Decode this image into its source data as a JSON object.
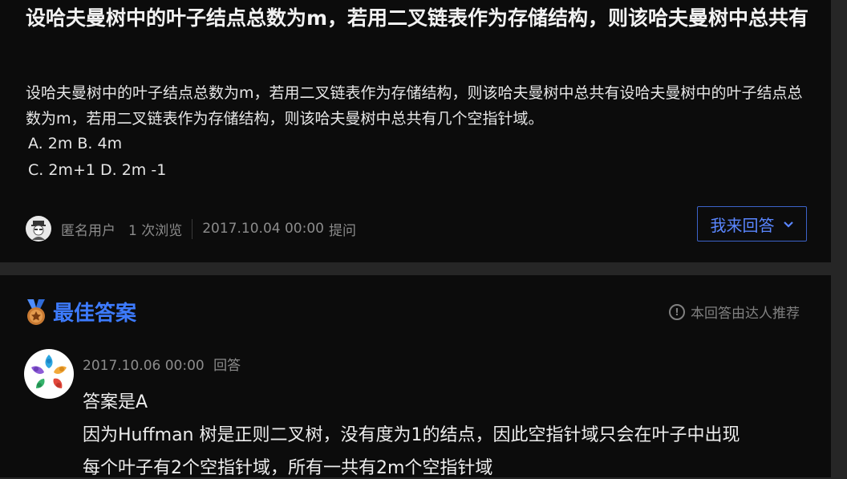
{
  "question": {
    "title": "设哈夫曼树中的叶子结点总数为m，若用二叉链表作为存储结构，则该哈夫曼树中总共有",
    "body": "设哈夫曼树中的叶子结点总数为m，若用二叉链表作为存储结构，则该哈夫曼树中总共有设哈夫曼树中的叶子结点总数为m，若用二叉链表作为存储结构，则该哈夫曼树中总共有几个空指针域。",
    "options": [
      "A. 2m B. 4m",
      "C. 2m+1 D. 2m -1"
    ],
    "meta": {
      "user": "匿名用户",
      "views": "1 次浏览",
      "date": "2017.10.04 00:00",
      "action": "提问"
    },
    "answer_button": "我来回答"
  },
  "best_answer": {
    "title": "最佳答案",
    "recommend_note": "本回答由达人推荐",
    "date": "2017.10.06 00:00",
    "action": "回答",
    "lines": [
      "答案是A",
      "因为Huffman 树是正则二叉树，没有度为1的结点，因此空指针域只会在叶子中出现",
      "每个叶子有2个空指针域，所有一共有2m个空指针域"
    ]
  },
  "colors": {
    "accent": "#3d7bff",
    "button_text": "#5a86ff",
    "card_bg": "#0c0c0c",
    "page_bg": "#262626"
  },
  "icons": [
    "anonymous-avatar-icon",
    "chevron-down-icon",
    "medal-icon",
    "info-icon",
    "user-avatar-icon"
  ]
}
